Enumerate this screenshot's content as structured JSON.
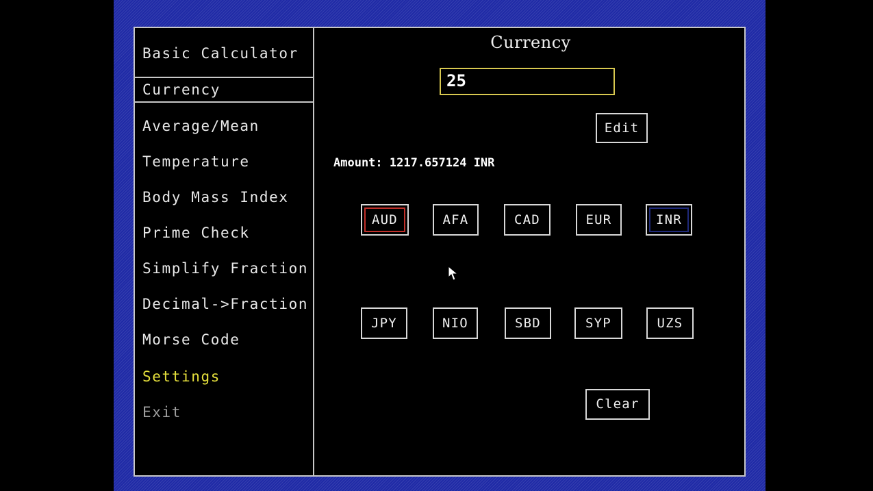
{
  "sidebar": {
    "items": [
      {
        "label": "Basic Calculator"
      },
      {
        "label": "Currency"
      },
      {
        "label": "Average/Mean"
      },
      {
        "label": "Temperature"
      },
      {
        "label": "Body Mass Index"
      },
      {
        "label": "Prime Check"
      },
      {
        "label": "Simplify Fraction"
      },
      {
        "label": "Decimal->Fraction"
      },
      {
        "label": "Morse Code"
      },
      {
        "label": "Settings"
      },
      {
        "label": "Exit"
      }
    ],
    "selected": "Currency"
  },
  "panel": {
    "title": "Currency",
    "input_value": "25",
    "edit_label": "Edit",
    "amount_text": "Amount: 1217.657124 INR",
    "clear_label": "Clear",
    "from_currency": "AUD",
    "to_currency": "INR",
    "currencies_row1": [
      "AUD",
      "AFA",
      "CAD",
      "EUR",
      "INR"
    ],
    "currencies_row2": [
      "JPY",
      "NIO",
      "SBD",
      "SYP",
      "UZS"
    ]
  },
  "colors": {
    "background_pattern": "#1f2aa6",
    "from_highlight": "#c0302a",
    "to_highlight": "#1f2a7a",
    "input_border": "#d8c850",
    "settings_text": "#e6e03c",
    "exit_text": "#a0a0a0"
  }
}
